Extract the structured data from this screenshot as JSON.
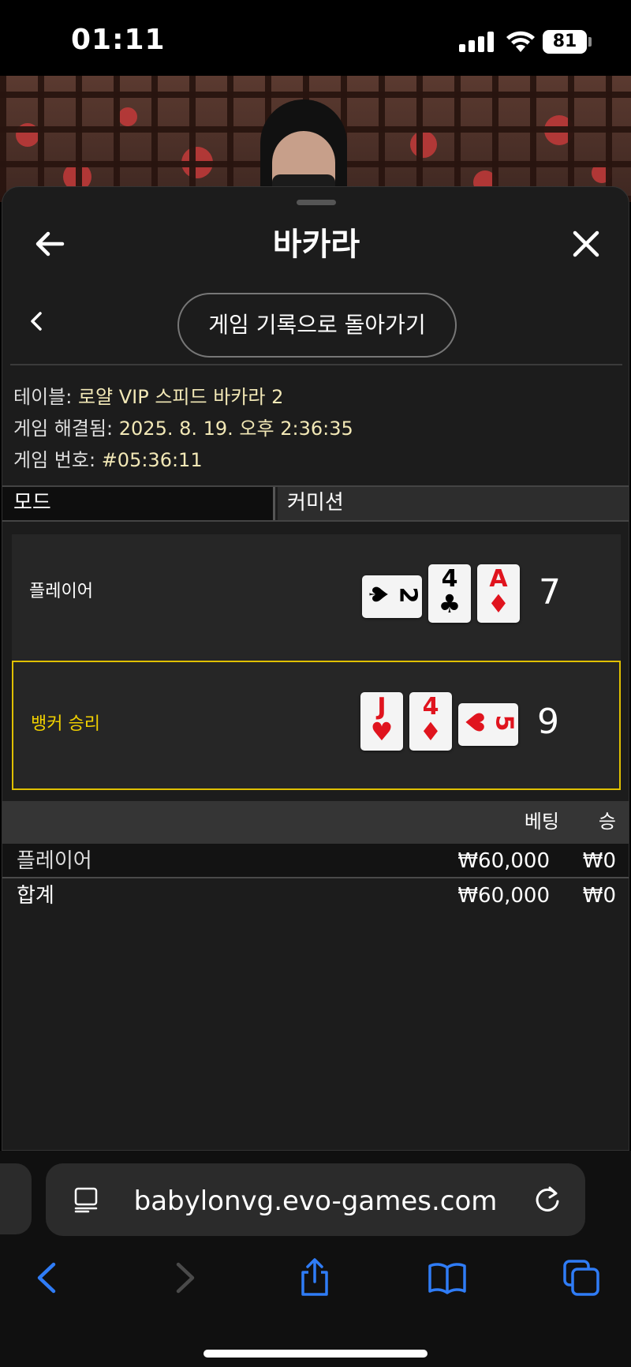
{
  "status_bar": {
    "time": "01:11",
    "battery": "81"
  },
  "sheet": {
    "title": "바카라",
    "back_to_history": "게임 기록으로 돌아가기"
  },
  "info": {
    "table_label": "테이블:",
    "table_value": "로얄 VIP 스피드 바카라 2",
    "resolved_label": "게임 해결됨:",
    "resolved_value": "2025. 8. 19. 오후 2:36:35",
    "game_no_label": "게임 번호:",
    "game_no_value": "#05:36:11"
  },
  "mode": {
    "mode_label": "모드",
    "commission_label": "커미션"
  },
  "hands": {
    "player": {
      "label": "플레이어",
      "score": "7",
      "cards": [
        {
          "rank": "2",
          "suit": "♠",
          "color": "black"
        },
        {
          "rank": "4",
          "suit": "♣",
          "color": "black"
        },
        {
          "rank": "A",
          "suit": "♦",
          "color": "red"
        }
      ]
    },
    "banker": {
      "label": "뱅커 승리",
      "score": "9",
      "cards": [
        {
          "rank": "J",
          "suit": "♥",
          "color": "red"
        },
        {
          "rank": "4",
          "suit": "♦",
          "color": "red"
        },
        {
          "rank": "5",
          "suit": "♥",
          "color": "red"
        }
      ]
    }
  },
  "bets": {
    "header_bet": "베팅",
    "header_win": "승",
    "rows": [
      {
        "name": "플레이어",
        "bet": "₩60,000",
        "win": "₩0"
      },
      {
        "name": "합계",
        "bet": "₩60,000",
        "win": "₩0"
      }
    ]
  },
  "browser": {
    "url": "babylonvg.evo-games.com"
  },
  "colors": {
    "winner_accent": "#e0c000",
    "info_value": "#f2e8b6",
    "ios_blue": "#2f7cf6"
  }
}
